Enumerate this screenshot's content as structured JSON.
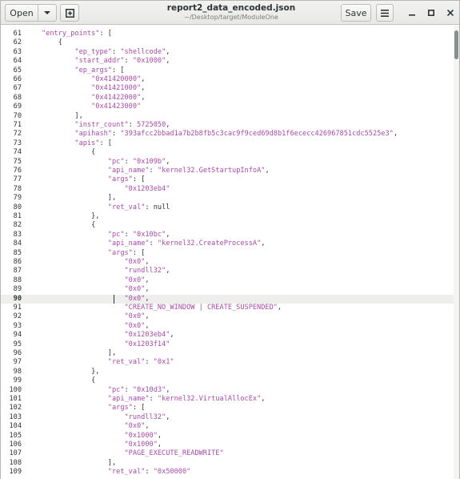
{
  "headerbar": {
    "open_label": "Open",
    "open_menu_icon": "chevron-down-icon",
    "new_tab_icon": "new-tab-icon",
    "title": "report2_data_encoded.json",
    "subtitle": "~/Desktop/target/ModuleOne",
    "save_label": "Save",
    "menu_icon": "hamburger-menu-icon",
    "minimize_icon": "minimize-icon",
    "maximize_icon": "maximize-icon",
    "close_icon": "close-icon"
  },
  "editor": {
    "current_line": 90,
    "lines": [
      {
        "n": "61",
        "text": "\"entry_points\": ["
      },
      {
        "n": "62",
        "text": "    {"
      },
      {
        "n": "63",
        "text": "        \"ep_type\": \"shellcode\","
      },
      {
        "n": "64",
        "text": "        \"start_addr\": \"0x1000\","
      },
      {
        "n": "65",
        "text": "        \"ep_args\": ["
      },
      {
        "n": "66",
        "text": "            \"0x41420000\","
      },
      {
        "n": "67",
        "text": "            \"0x41421000\","
      },
      {
        "n": "68",
        "text": "            \"0x41422000\","
      },
      {
        "n": "69",
        "text": "            \"0x41423000\""
      },
      {
        "n": "70",
        "text": "        ],"
      },
      {
        "n": "71",
        "text": "        \"instr_count\": 5725050,"
      },
      {
        "n": "72",
        "text": "        \"apihash\": \"393afcc2bbad1a7b2b8fb5c3cac9f9ced69d8b1f6ececc426967851cdc5525e3\","
      },
      {
        "n": "73",
        "text": "        \"apis\": ["
      },
      {
        "n": "74",
        "text": "            {"
      },
      {
        "n": "75",
        "text": "                \"pc\": \"0x109b\","
      },
      {
        "n": "76",
        "text": "                \"api_name\": \"kernel32.GetStartupInfoA\","
      },
      {
        "n": "77",
        "text": "                \"args\": ["
      },
      {
        "n": "78",
        "text": "                    \"0x1203eb4\""
      },
      {
        "n": "79",
        "text": "                ],"
      },
      {
        "n": "80",
        "text": "                \"ret_val\": null"
      },
      {
        "n": "81",
        "text": "            },"
      },
      {
        "n": "82",
        "text": "            {"
      },
      {
        "n": "83",
        "text": "                \"pc\": \"0x10bc\","
      },
      {
        "n": "84",
        "text": "                \"api_name\": \"kernel32.CreateProcessA\","
      },
      {
        "n": "85",
        "text": "                \"args\": ["
      },
      {
        "n": "86",
        "text": "                    \"0x0\","
      },
      {
        "n": "87",
        "text": "                    \"rundll32\","
      },
      {
        "n": "88",
        "text": "                    \"0x0\","
      },
      {
        "n": "89",
        "text": "                    \"0x0\","
      },
      {
        "n": "90",
        "text": "                    \"0x0\","
      },
      {
        "n": "91",
        "text": "                    \"CREATE_NO_WINDOW | CREATE_SUSPENDED\","
      },
      {
        "n": "92",
        "text": "                    \"0x0\","
      },
      {
        "n": "93",
        "text": "                    \"0x0\","
      },
      {
        "n": "94",
        "text": "                    \"0x1203eb4\","
      },
      {
        "n": "95",
        "text": "                    \"0x1203f14\""
      },
      {
        "n": "96",
        "text": "                ],"
      },
      {
        "n": "97",
        "text": "                \"ret_val\": \"0x1\""
      },
      {
        "n": "98",
        "text": "            },"
      },
      {
        "n": "99",
        "text": "            {"
      },
      {
        "n": "100",
        "text": "                \"pc\": \"0x10d3\","
      },
      {
        "n": "101",
        "text": "                \"api_name\": \"kernel32.VirtualAllocEx\","
      },
      {
        "n": "102",
        "text": "                \"args\": ["
      },
      {
        "n": "103",
        "text": "                    \"rundll32\","
      },
      {
        "n": "104",
        "text": "                    \"0x0\","
      },
      {
        "n": "105",
        "text": "                    \"0x1000\","
      },
      {
        "n": "106",
        "text": "                    \"0x1000\","
      },
      {
        "n": "107",
        "text": "                    \"PAGE_EXECUTE_READWRITE\""
      },
      {
        "n": "108",
        "text": "                ],"
      },
      {
        "n": "109",
        "text": "                \"ret_val\": \"0x50000\""
      }
    ]
  },
  "colors": {
    "string": "#a64ca6",
    "text": "#2e3436",
    "current_line": "#eeeeec"
  }
}
